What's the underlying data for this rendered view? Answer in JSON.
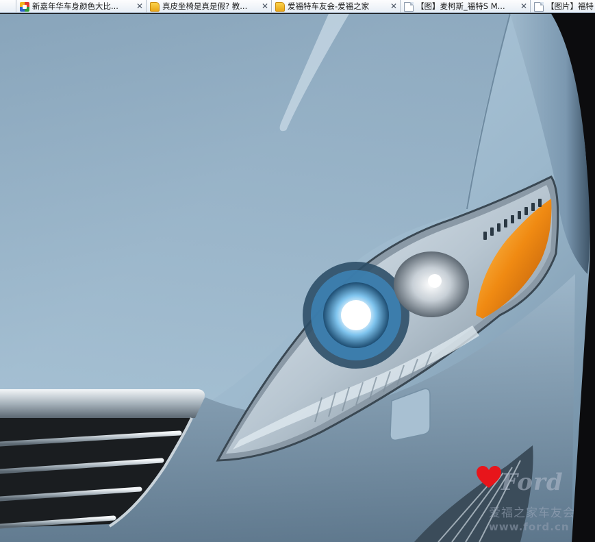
{
  "tabs": [
    {
      "label": "新嘉年华车身颜色大比...",
      "icon": "colorful-cube-icon"
    },
    {
      "label": "真皮坐椅是真是假? 教...",
      "icon": "folder-favicon-icon"
    },
    {
      "label": "爱福特车友会-爱福之家",
      "icon": "folder-favicon-icon"
    },
    {
      "label": "【图】麦柯斯_福特S M...",
      "icon": "blank-page-icon"
    },
    {
      "label": "【图片】福特",
      "icon": "blank-page-icon"
    }
  ],
  "close_glyph": "✕",
  "watermark": {
    "brand": "Ford",
    "text": "爱福之家车友会",
    "url": "www.ford.cn"
  },
  "colors": {
    "car_paint": "#8fadc4",
    "tab_bg": "#eef3f9",
    "heart": "#e8151b",
    "amber_indicator": "#f08a12"
  }
}
